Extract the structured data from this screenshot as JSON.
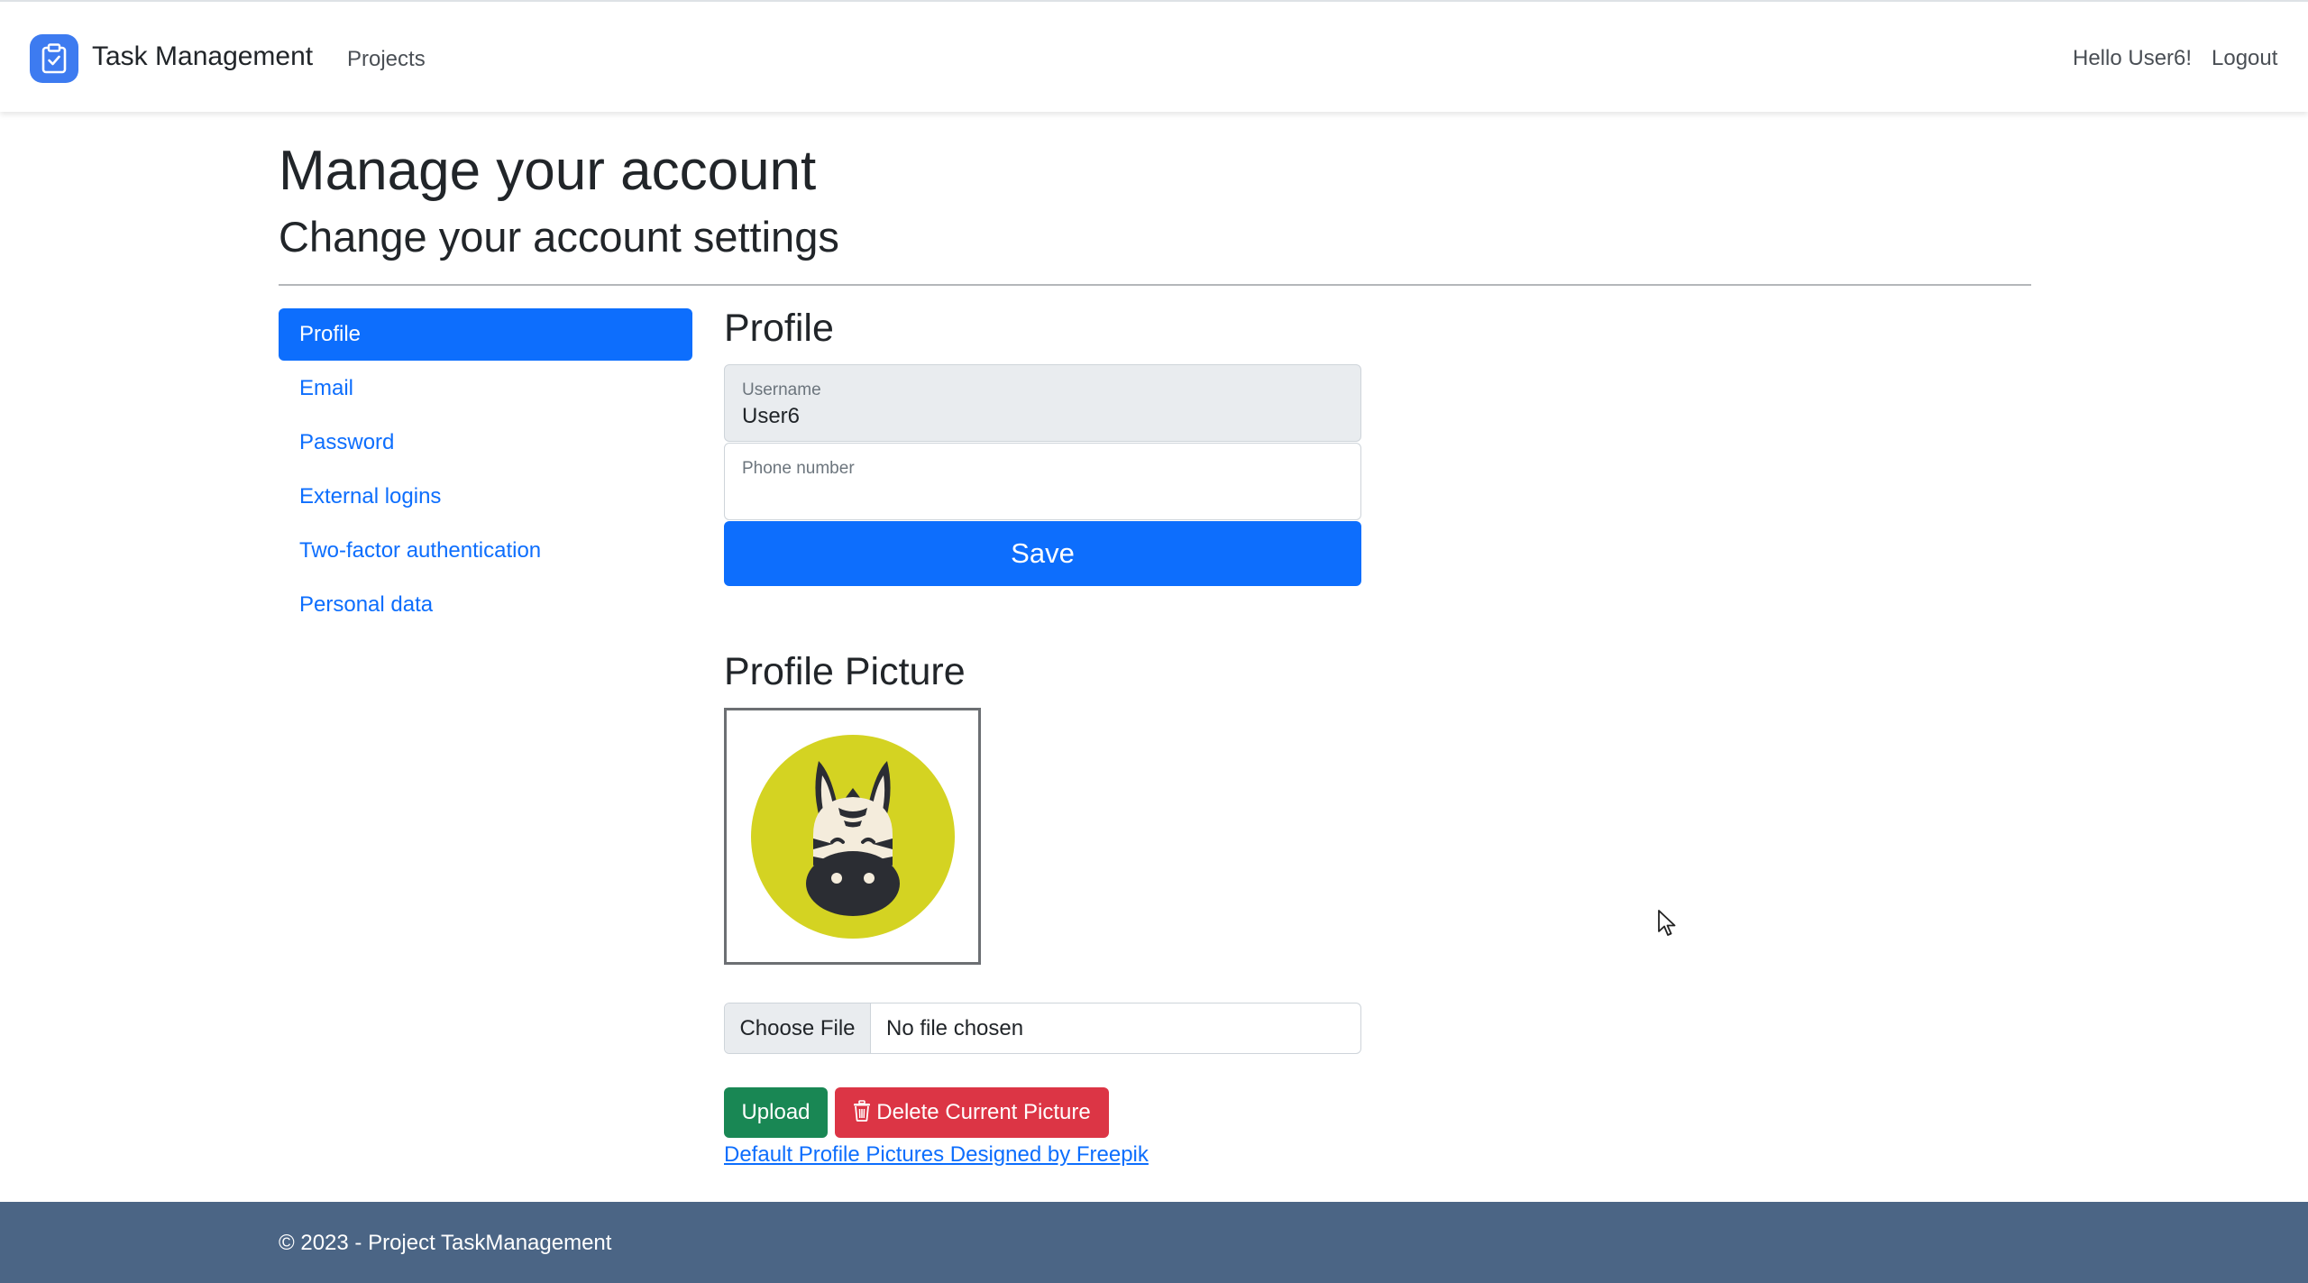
{
  "navbar": {
    "brand": "Task Management",
    "projects_link": "Projects",
    "greeting": "Hello User6!",
    "logout": "Logout"
  },
  "page": {
    "title": "Manage your account",
    "subtitle": "Change your account settings"
  },
  "sidebar": {
    "items": [
      {
        "label": "Profile",
        "active": true
      },
      {
        "label": "Email",
        "active": false
      },
      {
        "label": "Password",
        "active": false
      },
      {
        "label": "External logins",
        "active": false
      },
      {
        "label": "Two-factor authentication",
        "active": false
      },
      {
        "label": "Personal data",
        "active": false
      }
    ]
  },
  "profile": {
    "heading": "Profile",
    "username_label": "Username",
    "username_value": "User6",
    "phone_label": "Phone number",
    "phone_value": "",
    "save_label": "Save"
  },
  "picture": {
    "heading": "Profile Picture",
    "choose_file": "Choose File",
    "no_file": "No file chosen",
    "upload": "Upload",
    "delete": "Delete Current Picture",
    "credit_link": "Default Profile Pictures Designed by Freepik"
  },
  "footer": {
    "text": "© 2023 - Project TaskManagement"
  },
  "colors": {
    "primary": "#0d6efd",
    "success": "#198754",
    "danger": "#dc3545",
    "footer_bg": "#4b6585",
    "avatar_bg": "#d4d322"
  },
  "icons": [
    "clipboard-check-icon",
    "trash-icon",
    "zebra-avatar",
    "mouse-cursor-icon"
  ]
}
